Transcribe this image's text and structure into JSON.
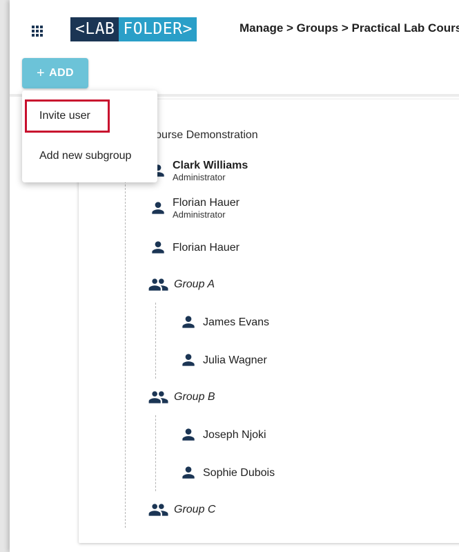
{
  "logo": {
    "part1": "<LAB",
    "part2": "FOLDER>"
  },
  "breadcrumb": "Manage > Groups > Practical Lab Course",
  "add_button": {
    "label": "ADD",
    "plus": "+"
  },
  "menu": {
    "items": [
      "Invite user",
      "Add new subgroup"
    ]
  },
  "tree": {
    "title": "ical Lab Course Demonstration",
    "members": [
      {
        "name": "Clark Williams",
        "role": "Administrator"
      },
      {
        "name": "Florian Hauer",
        "role": "Administrator"
      },
      {
        "name": "Florian Hauer",
        "role": ""
      }
    ],
    "groups": [
      {
        "name": "Group A",
        "members": [
          "James Evans",
          "Julia Wagner"
        ]
      },
      {
        "name": "Group B",
        "members": [
          "Joseph Njoki",
          "Sophie Dubois"
        ]
      },
      {
        "name": "Group C",
        "members": []
      }
    ]
  },
  "icons": {
    "apps": "apps-grid-icon",
    "person": "person-icon",
    "group": "group-icon"
  },
  "colors": {
    "logo_dark": "#1b3554",
    "logo_accent": "#2a9fc8",
    "add_button": "#6cc3d8",
    "icon": "#1b3554",
    "highlight": "#c8102e"
  }
}
